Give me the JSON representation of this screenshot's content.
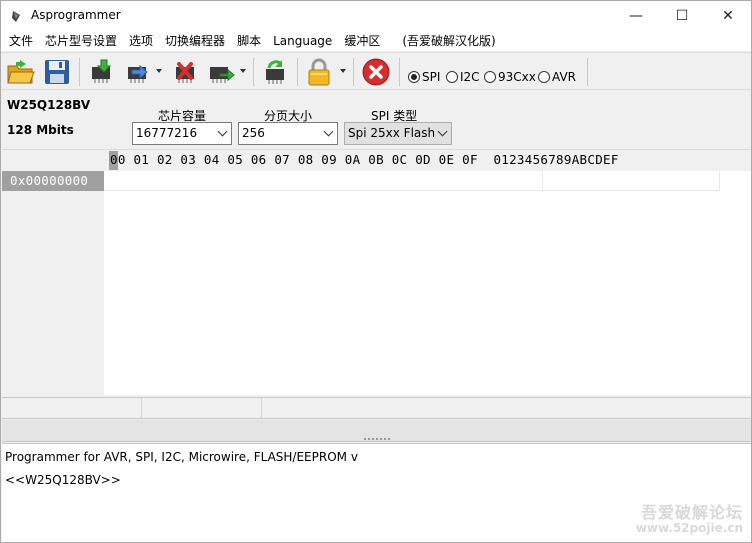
{
  "window": {
    "title": "Asprogrammer",
    "minimize_glyph": "—",
    "maximize_glyph": "☐",
    "close_glyph": "✕"
  },
  "menu": [
    "文件",
    "芯片型号设置",
    "选项",
    "切换编程器",
    "脚本",
    "Language",
    "缓冲区",
    "(吾爱破解汉化版)"
  ],
  "toolbar": {
    "protocols": [
      {
        "label": "SPI",
        "selected": true
      },
      {
        "label": "I2C",
        "selected": false
      },
      {
        "label": "93Cxx",
        "selected": false
      },
      {
        "label": "AVR",
        "selected": false
      }
    ]
  },
  "chip": {
    "name": "W25Q128BV",
    "size_text": "128 Mbits",
    "capacity_label": "芯片容量",
    "capacity_value": "16777216",
    "page_label": "分页大小",
    "page_value": "256",
    "spi_type_label": "SPI 类型",
    "spi_type_value": "Spi 25xx Flash"
  },
  "hex": {
    "header": "00 01 02 03 04 05 06 07 08 09 0A 0B 0C 0D 0E 0F  0123456789ABCDEF",
    "address": "0x00000000"
  },
  "log": {
    "lines": [
      "Programmer for AVR, SPI, I2C, Microwire, FLASH/EEPROM v",
      "<<W25Q128BV>>"
    ]
  },
  "watermark": {
    "line1": "吾爱破解论坛",
    "line2": "www.52pojie.cn"
  },
  "colors": {
    "window_bg": "#f0f0f0",
    "address_bg": "#a0a0a0",
    "error_red": "#d32f2f",
    "chip_green": "#3f7f3f"
  }
}
